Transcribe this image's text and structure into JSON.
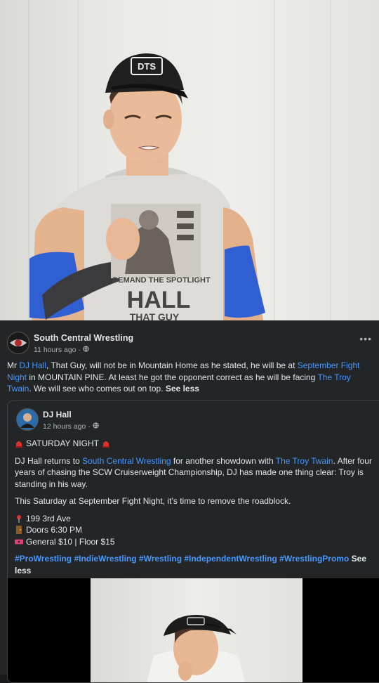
{
  "post": {
    "page_name": "South Central Wrestling",
    "time": "11 hours ago",
    "more_icon": "more-icon",
    "text_parts": {
      "p1": "Mr ",
      "link1": "DJ Hall",
      "p2": ", That Guy, will not be in Mountain Home as he stated, he will be at ",
      "link2": "September Fight Night",
      "p3": " in MOUNTAIN PINE. At least he got the opponent correct as he will be facing ",
      "link3": "The Troy Twain",
      "p4": ". We will see who comes out on top. ",
      "see_less": "See less"
    }
  },
  "shared": {
    "name": "DJ Hall",
    "time": "12 hours ago",
    "headline": "SATURDAY NIGHT",
    "intro_1": "DJ Hall returns to ",
    "intro_link1": "South Central Wrestling",
    "intro_2": " for another showdown with ",
    "intro_link2": "The Troy Twain",
    "intro_3": ". After four years of chasing the SCW Cruiserweight Championship, DJ has made one thing clear: Troy is standing in his way.",
    "paragraph_2": "This Saturday at September Fight Night, it’s time to remove the roadblock.",
    "address": "199 3rd Ave",
    "doors": "Doors 6:30 PM",
    "tickets": "General $10 | Floor $15",
    "hashtags": "#ProWrestling #IndieWrestling #Wrestling #IndependentWrestling #WrestlingPromo",
    "see_less": "See less"
  },
  "hero": {
    "cap_text": "DTS",
    "shirt_line1": "DEMAND THE SPOTLIGHT",
    "shirt_line2": "HALL",
    "shirt_line3": "THAT GUY"
  }
}
